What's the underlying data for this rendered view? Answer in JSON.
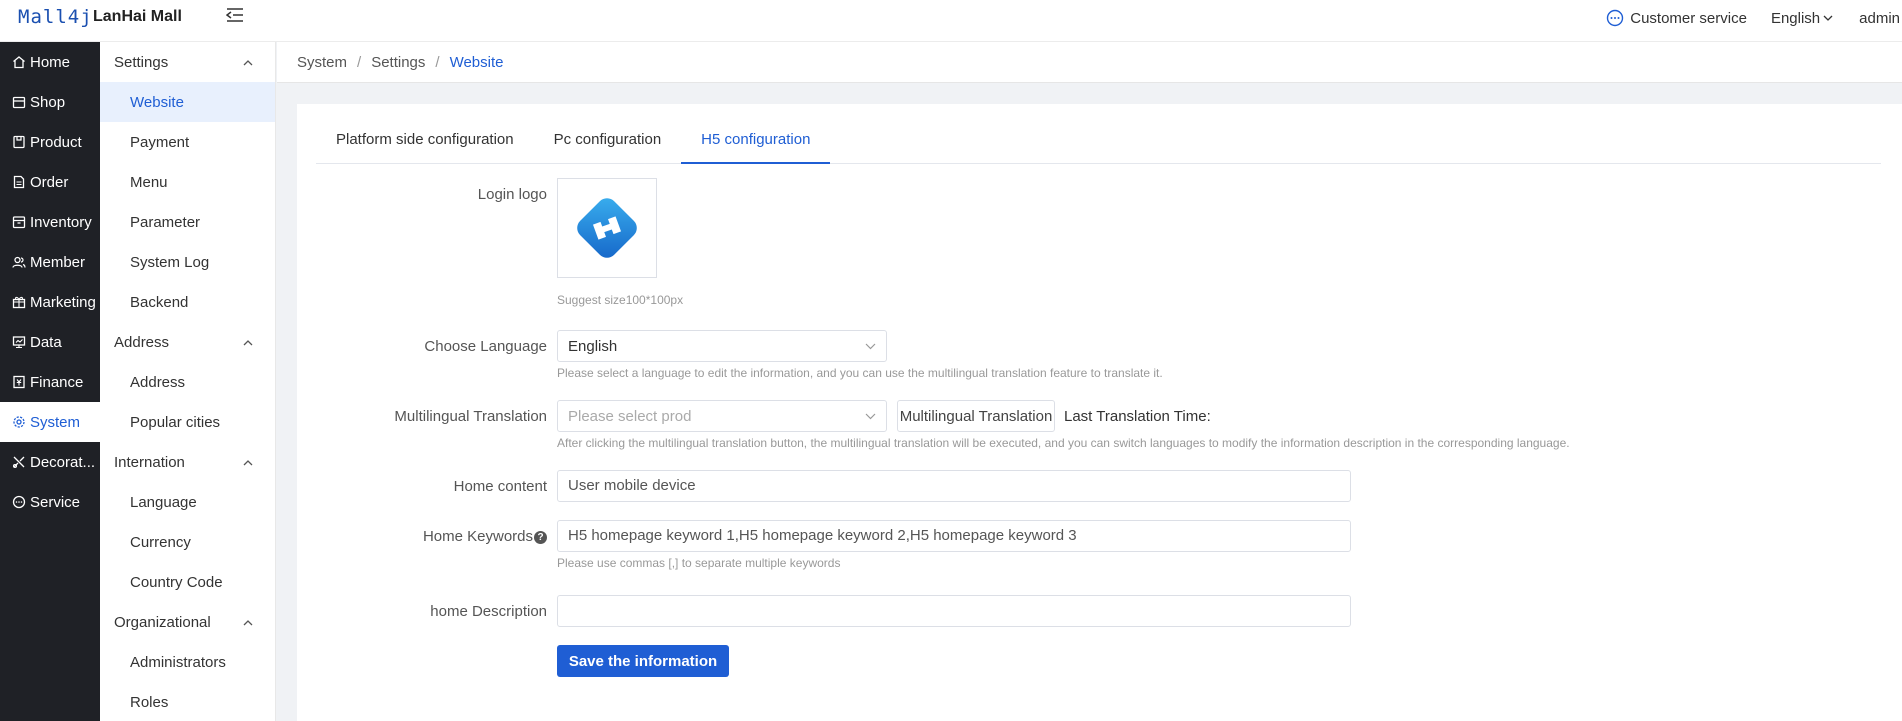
{
  "header": {
    "logo_text": "Mall4j",
    "app_name": "LanHai Mall",
    "customer_service": "Customer service",
    "language": "English",
    "user": "admin"
  },
  "sidebar": {
    "items": [
      {
        "label": "Home",
        "icon": "home-icon"
      },
      {
        "label": "Shop",
        "icon": "shop-icon"
      },
      {
        "label": "Product",
        "icon": "product-icon"
      },
      {
        "label": "Order",
        "icon": "order-icon"
      },
      {
        "label": "Inventory",
        "icon": "inventory-icon"
      },
      {
        "label": "Member",
        "icon": "member-icon"
      },
      {
        "label": "Marketing",
        "icon": "marketing-icon"
      },
      {
        "label": "Data",
        "icon": "data-icon"
      },
      {
        "label": "Finance",
        "icon": "finance-icon"
      },
      {
        "label": "System",
        "icon": "gear-icon"
      },
      {
        "label": "Decorat...",
        "icon": "decoration-icon"
      },
      {
        "label": "Service",
        "icon": "service-icon"
      }
    ],
    "active_index": 9,
    "accent_color": "#1f5ed4"
  },
  "submenu": {
    "groups": [
      {
        "title": "Settings",
        "items": [
          "Website",
          "Payment",
          "Menu",
          "Parameter",
          "System Log",
          "Backend"
        ]
      },
      {
        "title": "Address",
        "items": [
          "Address",
          "Popular cities"
        ]
      },
      {
        "title": "Internation",
        "items": [
          "Language",
          "Currency",
          "Country Code"
        ]
      },
      {
        "title": "Organizational",
        "items": [
          "Administrators",
          "Roles"
        ]
      }
    ],
    "active_item": "Website"
  },
  "breadcrumb": [
    "System",
    "Settings",
    "Website"
  ],
  "tabs": [
    "Platform side configuration",
    "Pc configuration",
    "H5 configuration"
  ],
  "active_tab": 2,
  "form": {
    "login_logo_label": "Login logo",
    "logo_hint": "Suggest size100*100px",
    "language_label": "Choose Language",
    "language_value": "English",
    "language_help": "Please select a language to edit the information, and you can use the multilingual translation feature to translate it.",
    "translation_label": "Multilingual Translation",
    "translation_placeholder": "Please select prod",
    "translation_button": "Multilingual Translation",
    "last_translation_time": "Last Translation Time:",
    "translation_help": "After clicking the multilingual translation button, the multilingual translation will be executed, and you can switch languages to modify the information description in the corresponding language.",
    "home_content_label": "Home content",
    "home_content_value": "User mobile device",
    "home_keywords_label": "Home Keywords",
    "home_keywords_value": "H5 homepage keyword 1,H5 homepage keyword 2,H5 homepage keyword 3",
    "home_keywords_help": "Please use commas [,] to separate multiple keywords",
    "home_description_label": "home Description",
    "home_description_value": "",
    "save_button": "Save the information"
  }
}
